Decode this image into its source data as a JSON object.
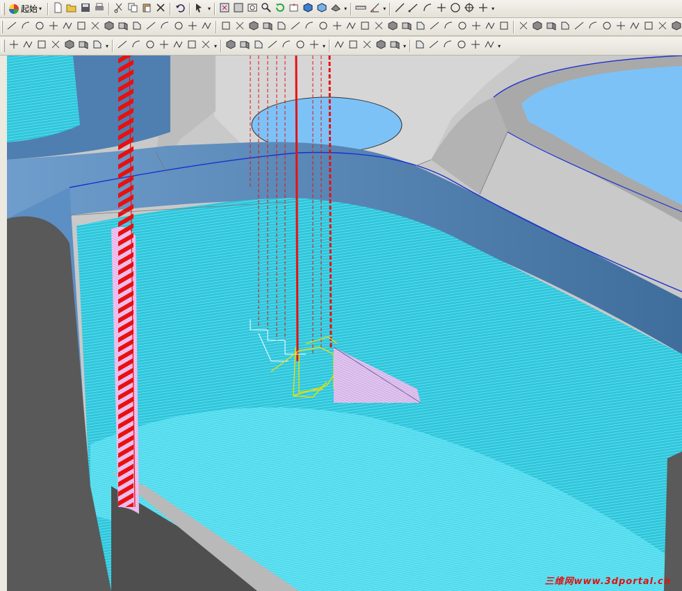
{
  "toolbar1": {
    "start_label": "起始",
    "groups": [
      [
        "new-file-icon",
        "open-folder-icon",
        "save-icon",
        "print-icon"
      ],
      [
        "cut-icon",
        "copy-icon",
        "paste-icon",
        "delete-icon"
      ],
      [
        "undo-icon"
      ],
      [
        "selection-filter-icon"
      ],
      [
        "fit-view-icon",
        "zoom-window-icon",
        "zoom-area-icon",
        "zoom-icon",
        "rotate-icon",
        "pan-icon",
        "shaded-view-icon",
        "wireframe-view-icon",
        "view-direction-icon"
      ],
      [
        "measure-icon",
        "angle-icon"
      ],
      [
        "line-icon",
        "line-diagonal-icon",
        "arc-icon",
        "perpendicular-icon",
        "circle-icon",
        "circle-center-icon",
        "plus-icon"
      ]
    ]
  },
  "toolbar2": {
    "icon_count": 58
  },
  "toolbar3": {
    "icon_count": 32
  },
  "viewport": {
    "watermark": "三维网www.3dportal.cn",
    "colors": {
      "gray_surface": "#cbcbcb",
      "dark_surface": "#585858",
      "steel_blue": "#5c8fc4",
      "cyan_toolpath": "#3ad4e6",
      "hole_blue": "#7cc2f7",
      "red_path": "#e81010",
      "yellow_path": "#e8e000",
      "pink_path": "#e9a9e9"
    }
  }
}
